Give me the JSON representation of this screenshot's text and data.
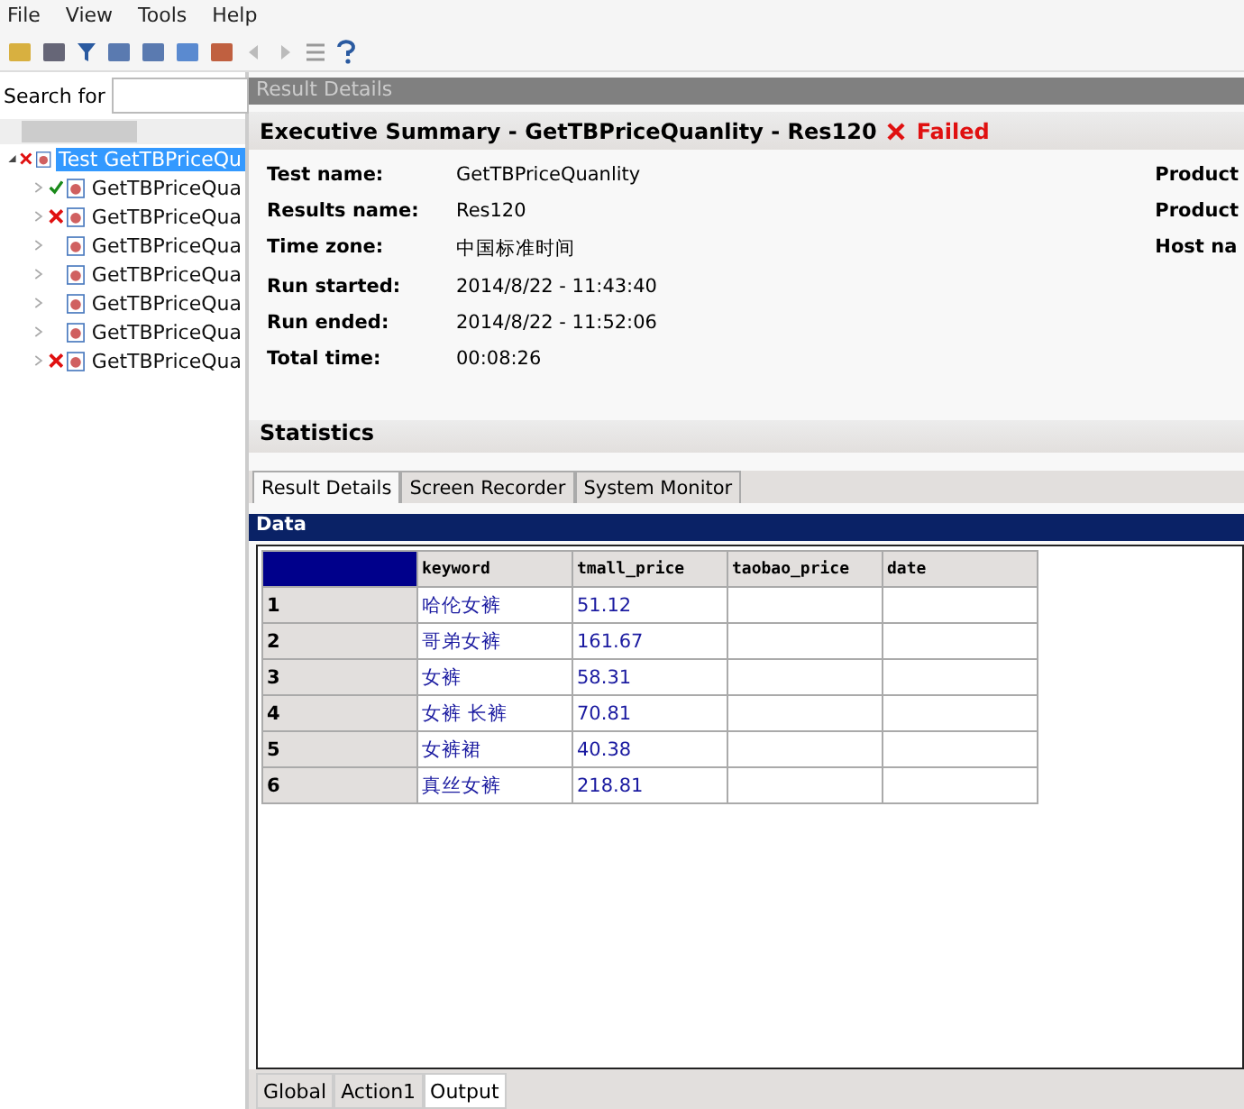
{
  "menu": [
    "File",
    "View",
    "Tools",
    "Help"
  ],
  "search": {
    "label": "Search for"
  },
  "tree": {
    "label": "Test GetTBPriceQu",
    "failed": true,
    "selected": true,
    "expanded": true,
    "children": [
      {
        "label": "GetTBPriceQua",
        "passed": true,
        "failed": false,
        "selected": false
      },
      {
        "label": "GetTBPriceQua",
        "passed": false,
        "failed": true,
        "selected": false
      },
      {
        "label": "GetTBPriceQua",
        "passed": false,
        "failed": false,
        "selected": false
      },
      {
        "label": "GetTBPriceQua",
        "passed": false,
        "failed": false,
        "selected": false
      },
      {
        "label": "GetTBPriceQua",
        "passed": false,
        "failed": false,
        "selected": false
      },
      {
        "label": "GetTBPriceQua",
        "passed": false,
        "failed": false,
        "selected": false
      },
      {
        "label": "GetTBPriceQua",
        "passed": false,
        "failed": true,
        "selected": false
      }
    ]
  },
  "panel_title": "Result Details",
  "summary": {
    "title": "Executive Summary - GetTBPriceQuanlity - Res120",
    "failed": true,
    "status_text": "Failed"
  },
  "details": [
    {
      "label": "Test name:",
      "value": "GetTBPriceQuanlity"
    },
    {
      "label": "Results name:",
      "value": "Res120"
    },
    {
      "label": "Time zone:",
      "value": "中国标准时间"
    },
    {
      "label": "Run started:",
      "value": "2014/8/22 - 11:43:40"
    },
    {
      "label": "Run ended:",
      "value": "2014/8/22 - 11:52:06"
    },
    {
      "label": "Total time:",
      "value": "00:08:26"
    }
  ],
  "details_right": [
    "Product",
    "Product",
    "Host na"
  ],
  "statistics": "Statistics",
  "tabs": [
    {
      "label": "Result Details",
      "selected": true
    },
    {
      "label": "Screen Recorder",
      "selected": false
    },
    {
      "label": "System Monitor",
      "selected": false
    }
  ],
  "data_title": "Data",
  "table": {
    "columns": [
      "",
      "keyword",
      "tmall_price",
      "taobao_price",
      "date"
    ],
    "rows": [
      [
        "1",
        "哈伦女裤",
        "51.12",
        "",
        ""
      ],
      [
        "2",
        "哥弟女裤",
        "161.67",
        "",
        ""
      ],
      [
        "3",
        "女裤",
        "58.31",
        "",
        ""
      ],
      [
        "4",
        "女裤 长裤",
        "70.81",
        "",
        ""
      ],
      [
        "5",
        "女裤裙",
        "40.38",
        "",
        ""
      ],
      [
        "6",
        "真丝女裤",
        "218.81",
        "",
        ""
      ]
    ]
  },
  "sheet_tabs": [
    {
      "label": "Global",
      "selected": false
    },
    {
      "label": "Action1",
      "selected": false
    },
    {
      "label": "Output",
      "selected": true
    }
  ]
}
